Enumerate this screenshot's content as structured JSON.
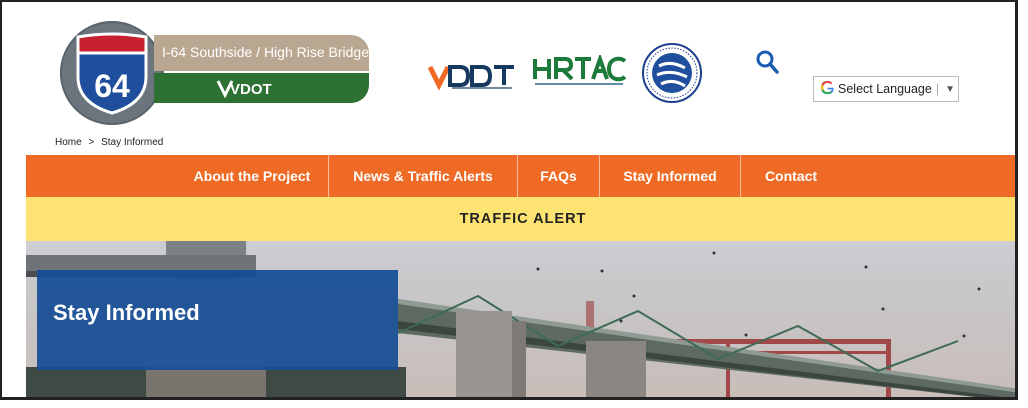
{
  "header": {
    "route_number": "64",
    "banner_text": "I-64 Southside / High Rise Bridge",
    "banner_brand": "VDOT",
    "partner_logos": [
      "vdot-logo",
      "hrtac-logo",
      "usdot-seal"
    ],
    "language": {
      "label": "Select Language",
      "arrow": "▼",
      "icon": "G"
    }
  },
  "breadcrumb": {
    "home": "Home",
    "separator": ">",
    "current": "Stay Informed"
  },
  "nav": {
    "items": [
      "About the Project",
      "News & Traffic Alerts",
      "FAQs",
      "Stay Informed",
      "Contact"
    ]
  },
  "alert": {
    "label": "TRAFFIC ALERT"
  },
  "hero": {
    "title": "Stay Informed"
  },
  "colors": {
    "nav": "#ef6a24",
    "alert": "#fde372",
    "hero_box": "#164e96",
    "banner_tan": "#b9a792",
    "banner_green": "#2e7233"
  }
}
